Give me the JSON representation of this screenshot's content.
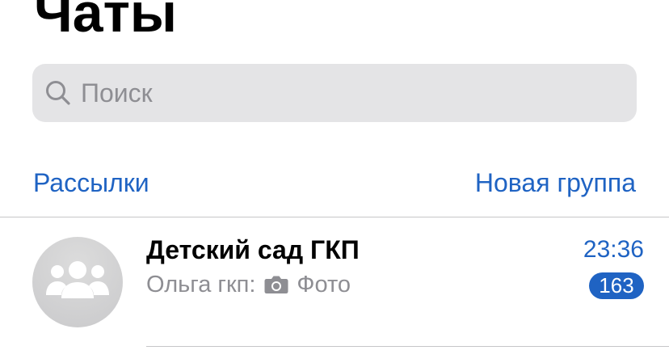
{
  "header": {
    "title": "Чаты"
  },
  "search": {
    "placeholder": "Поиск",
    "icon": "search-icon"
  },
  "actions": {
    "broadcast_label": "Рассылки",
    "new_group_label": "Новая группа"
  },
  "chats": [
    {
      "name": "Детский сад ГКП",
      "time": "23:36",
      "sender": "Ольга гкп:",
      "attachment_icon": "camera-icon",
      "preview": "Фото",
      "unread_count": "163",
      "avatar_icon": "group-icon"
    }
  ],
  "colors": {
    "accent": "#1f63c3",
    "secondary_text": "#8e8e93",
    "search_bg": "#e4e4e6",
    "avatar_bg": "#c9c9cb"
  }
}
